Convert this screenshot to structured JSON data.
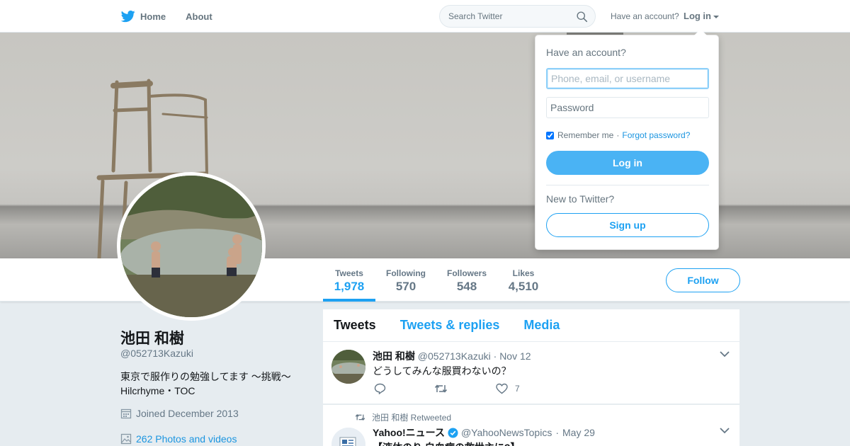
{
  "nav": {
    "home_label": "Home",
    "about_label": "About",
    "search_placeholder": "Search Twitter",
    "have_account": "Have an account?",
    "login_label": "Log in"
  },
  "profile": {
    "name": "池田 和樹",
    "handle": "@052713Kazuki",
    "bio_line1": "東京で服作りの勉強してます ～挑戦～",
    "bio_line2": "Hilcrhyme・TOC",
    "joined": "Joined December 2013",
    "photos": "262 Photos and videos"
  },
  "stats": [
    {
      "label": "Tweets",
      "value": "1,978",
      "active": true
    },
    {
      "label": "Following",
      "value": "570",
      "active": false
    },
    {
      "label": "Followers",
      "value": "548",
      "active": false
    },
    {
      "label": "Likes",
      "value": "4,510",
      "active": false
    }
  ],
  "follow_label": "Follow",
  "timeline": {
    "tabs": [
      "Tweets",
      "Tweets & replies",
      "Media"
    ],
    "tweet1": {
      "name": "池田 和樹",
      "handle": "@052713Kazuki",
      "sep": "·",
      "date": "Nov 12",
      "text": "どうしてみんな服買わないの？",
      "likes": "7"
    },
    "tweet2": {
      "retweet_note": "池田 和樹 Retweeted",
      "name": "Yahoo!ニュース",
      "handle": "@YahooNewsTopics",
      "sep": "·",
      "date": "May 29",
      "text": "【液体のり 白血病の救世主に?】"
    }
  },
  "login_dropdown": {
    "title": "Have an account?",
    "username_placeholder": "Phone, email, or username",
    "password_placeholder": "Password",
    "remember": "Remember me",
    "sep": "·",
    "forgot": "Forgot password?",
    "login_button": "Log in",
    "new_to": "New to Twitter?",
    "signup_button": "Sign up"
  },
  "colors": {
    "accent": "#1da1f2",
    "login_button": "#4ab3f4",
    "background": "#e6ecf0"
  }
}
